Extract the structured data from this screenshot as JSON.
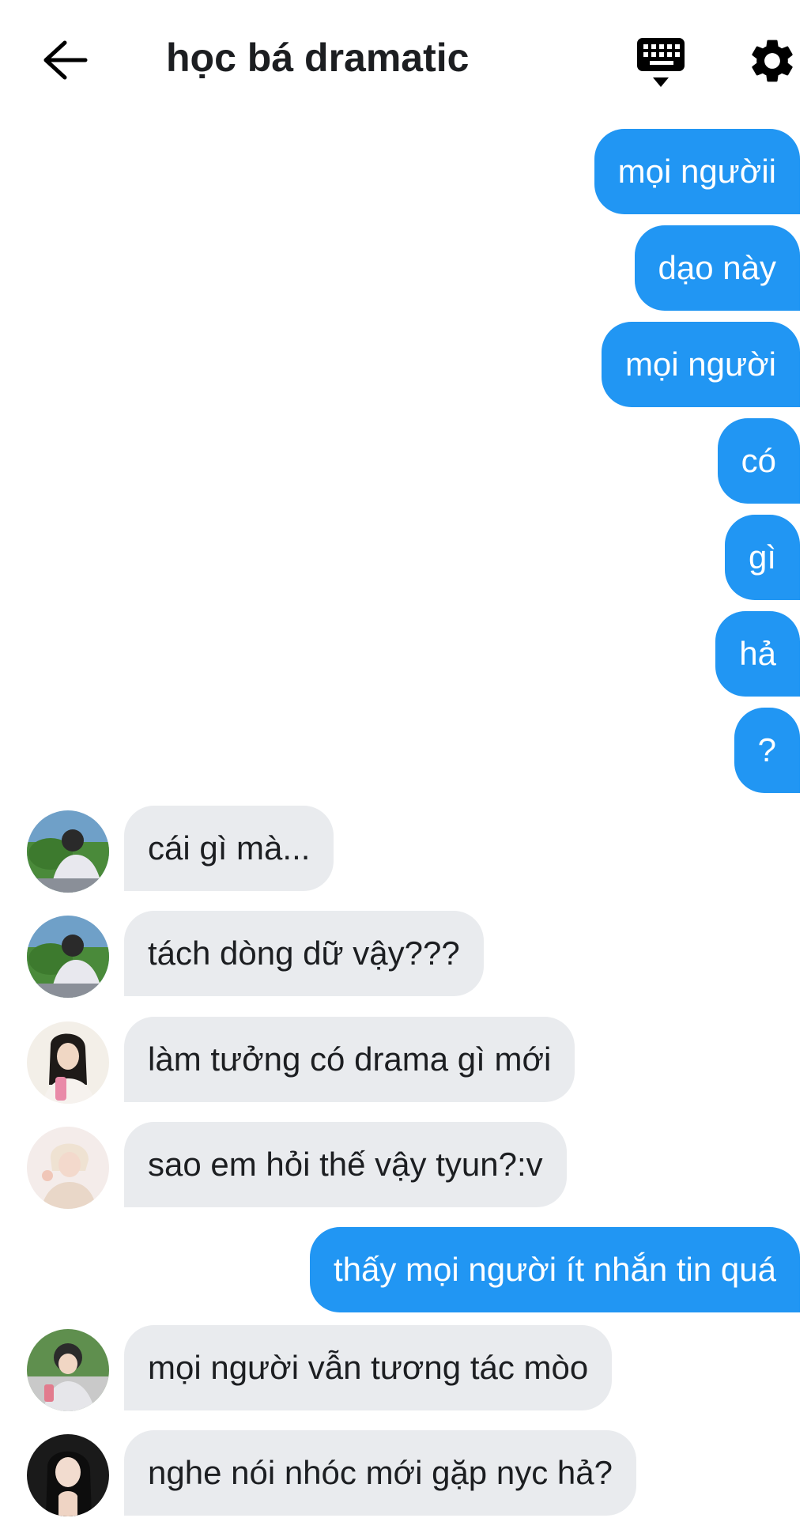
{
  "header": {
    "title": "học bá dramatic",
    "back_icon": "arrow-left-icon",
    "keyboard_icon": "keyboard-icon",
    "settings_icon": "gear-icon"
  },
  "colors": {
    "outgoing_bubble": "#2196f3",
    "incoming_bubble": "#e9ebee",
    "text_dark": "#1c1e21"
  },
  "messages": [
    {
      "direction": "out",
      "text": "mọi ngườii"
    },
    {
      "direction": "out",
      "text": "dạo này"
    },
    {
      "direction": "out",
      "text": "mọi người"
    },
    {
      "direction": "out",
      "text": "có"
    },
    {
      "direction": "out",
      "text": "gì"
    },
    {
      "direction": "out",
      "text": "hả"
    },
    {
      "direction": "out",
      "text": "?"
    },
    {
      "direction": "in",
      "text": "cái gì mà..."
    },
    {
      "direction": "in",
      "text": "tách dòng dữ vậy???"
    },
    {
      "direction": "in",
      "text": "làm tưởng có drama gì mới"
    },
    {
      "direction": "in",
      "text": "sao em hỏi thế vậy tyun?:v"
    },
    {
      "direction": "out",
      "text": "thấy mọi người ít nhắn tin quá"
    },
    {
      "direction": "in",
      "text": "mọi người vẫn tương tác mòo"
    },
    {
      "direction": "in",
      "text": "nghe nói nhóc mới gặp nyc hả?"
    }
  ]
}
